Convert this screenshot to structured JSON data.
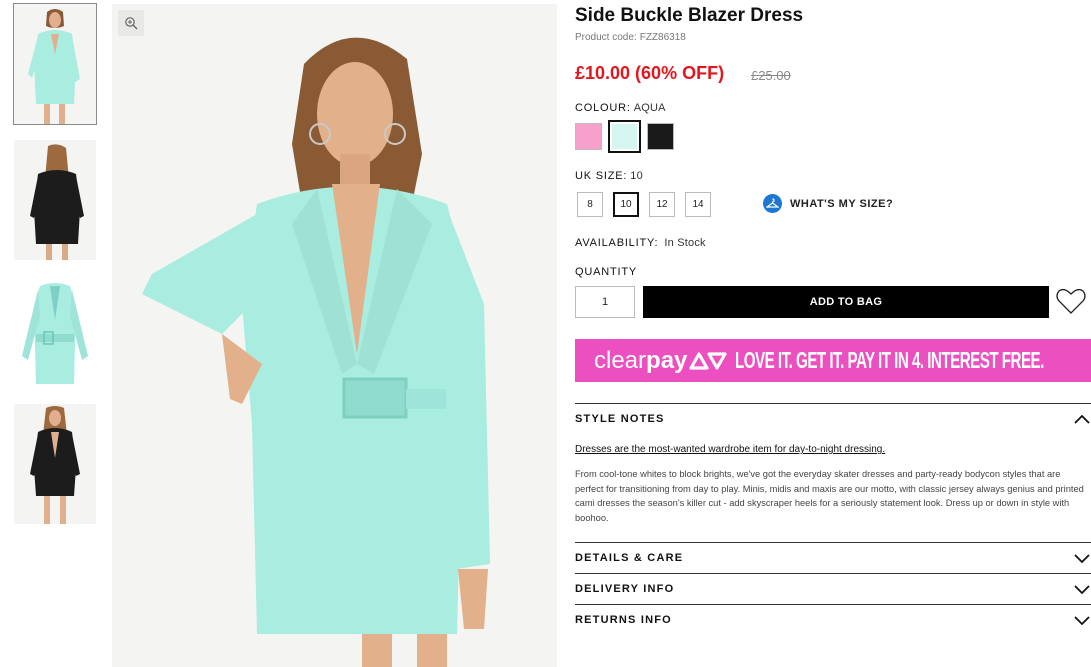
{
  "gallery": {
    "thumbnails": [
      {
        "name": "aqua-front",
        "colour": "#a9ece0"
      },
      {
        "name": "black-back",
        "colour": "#1c1c1c"
      },
      {
        "name": "aqua-flat",
        "colour": "#a9ece0"
      },
      {
        "name": "black-front",
        "colour": "#1c1c1c"
      }
    ],
    "zoom_icon": "zoom-in-icon"
  },
  "product": {
    "title": "Side Buckle Blazer Dress",
    "code_label": "Product code:",
    "code": "FZZ86318",
    "price": "£10.00 (60% OFF)",
    "was_price": "£25.00"
  },
  "colour": {
    "label": "COLOUR:",
    "value": "AQUA",
    "swatches": [
      {
        "name": "pink",
        "hex": "#f7a0cc"
      },
      {
        "name": "aqua",
        "hex": "#d7f6f1",
        "selected": true
      },
      {
        "name": "black",
        "hex": "#1a1a1a"
      }
    ]
  },
  "size": {
    "label": "UK SIZE:",
    "value": "10",
    "options": [
      "8",
      "10",
      "12",
      "14"
    ],
    "selected": "10",
    "whats_my_size": "WHAT'S MY SIZE?"
  },
  "availability": {
    "label": "AVAILABILITY:",
    "value": "In Stock"
  },
  "quantity": {
    "label": "QUANTITY",
    "value": "1"
  },
  "actions": {
    "add_to_bag": "ADD TO BAG"
  },
  "clearpay": {
    "brand_part1": "clear",
    "brand_part2": "pay",
    "tagline": "LOVE IT. GET IT. PAY IT IN 4. INTEREST FREE.",
    "color": "#ec4fbf"
  },
  "style_notes": {
    "title": "STYLE NOTES",
    "headline": "Dresses are the most-wanted wardrobe item for day-to-night dressing.",
    "body": "From cool-tone whites to block brights, we've got the everyday skater dresses and party-ready bodycon styles that are perfect for transitioning from day to play. Minis, midis and maxis are our motto, with classic jersey always genius and printed cami dresses the season's killer cut - add skyscraper heels for a seriously statement look. Dress up or down in style with boohoo."
  },
  "accordions": [
    {
      "title": "DETAILS & CARE"
    },
    {
      "title": "DELIVERY INFO"
    },
    {
      "title": "RETURNS INFO"
    }
  ],
  "colors": {
    "price_red": "#e4161d",
    "accent_blue": "#1e78d3",
    "black": "#000000"
  }
}
